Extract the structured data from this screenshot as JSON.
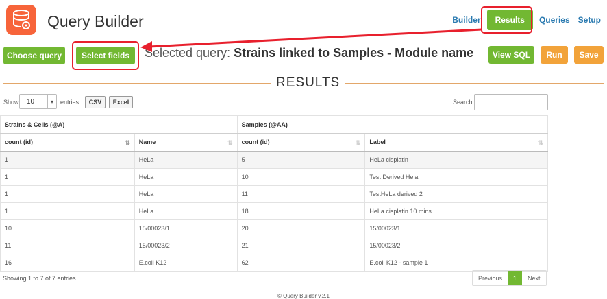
{
  "app": {
    "title": "Query Builder",
    "logo_icon": "database-gear-icon",
    "brand_color": "#f7643a"
  },
  "nav": [
    {
      "label": "Builder",
      "active": false
    },
    {
      "label": "Results",
      "active": true
    },
    {
      "label": "Queries",
      "active": false
    },
    {
      "label": "Setup",
      "active": false
    }
  ],
  "toolbar": {
    "choose_query": "Choose query",
    "select_fields": "Select fields",
    "selected_prefix": "Selected query:",
    "selected_name": "Strains linked to Samples - Module name",
    "view_sql": "View SQL",
    "run": "Run",
    "save": "Save"
  },
  "results": {
    "heading": "RESULTS",
    "show": "Show",
    "length": "10",
    "entries": "entries",
    "csv": "CSV",
    "excel": "Excel",
    "search_label": "Search:",
    "search_value": ""
  },
  "table": {
    "groups": [
      {
        "label": "Strains & Cells (@A)"
      },
      {
        "label": "Samples (@AA)"
      }
    ],
    "columns": [
      "count (id)",
      "Name",
      "count (id)",
      "Label"
    ],
    "rows": [
      [
        "1",
        "HeLa",
        "5",
        "HeLa cisplatin"
      ],
      [
        "1",
        "HeLa",
        "10",
        "Test Derived Hela"
      ],
      [
        "1",
        "HeLa",
        "11",
        "TestHeLa derived 2"
      ],
      [
        "1",
        "HeLa",
        "18",
        "HeLa cisplatin 10 mins"
      ],
      [
        "10",
        "15/00023/1",
        "20",
        "15/00023/1"
      ],
      [
        "11",
        "15/00023/2",
        "21",
        "15/00023/2"
      ],
      [
        "16",
        "E.coli K12",
        "62",
        "E.coli K12 - sample 1"
      ]
    ]
  },
  "footer": {
    "info": "Showing 1 to 7 of 7 entries",
    "previous": "Previous",
    "page": "1",
    "next": "Next",
    "credit": "© Query Builder v.2.1"
  },
  "colors": {
    "green": "#72b832",
    "orange": "#f2a33a",
    "link": "#2a7ab0",
    "highlight": "#e8202d"
  }
}
